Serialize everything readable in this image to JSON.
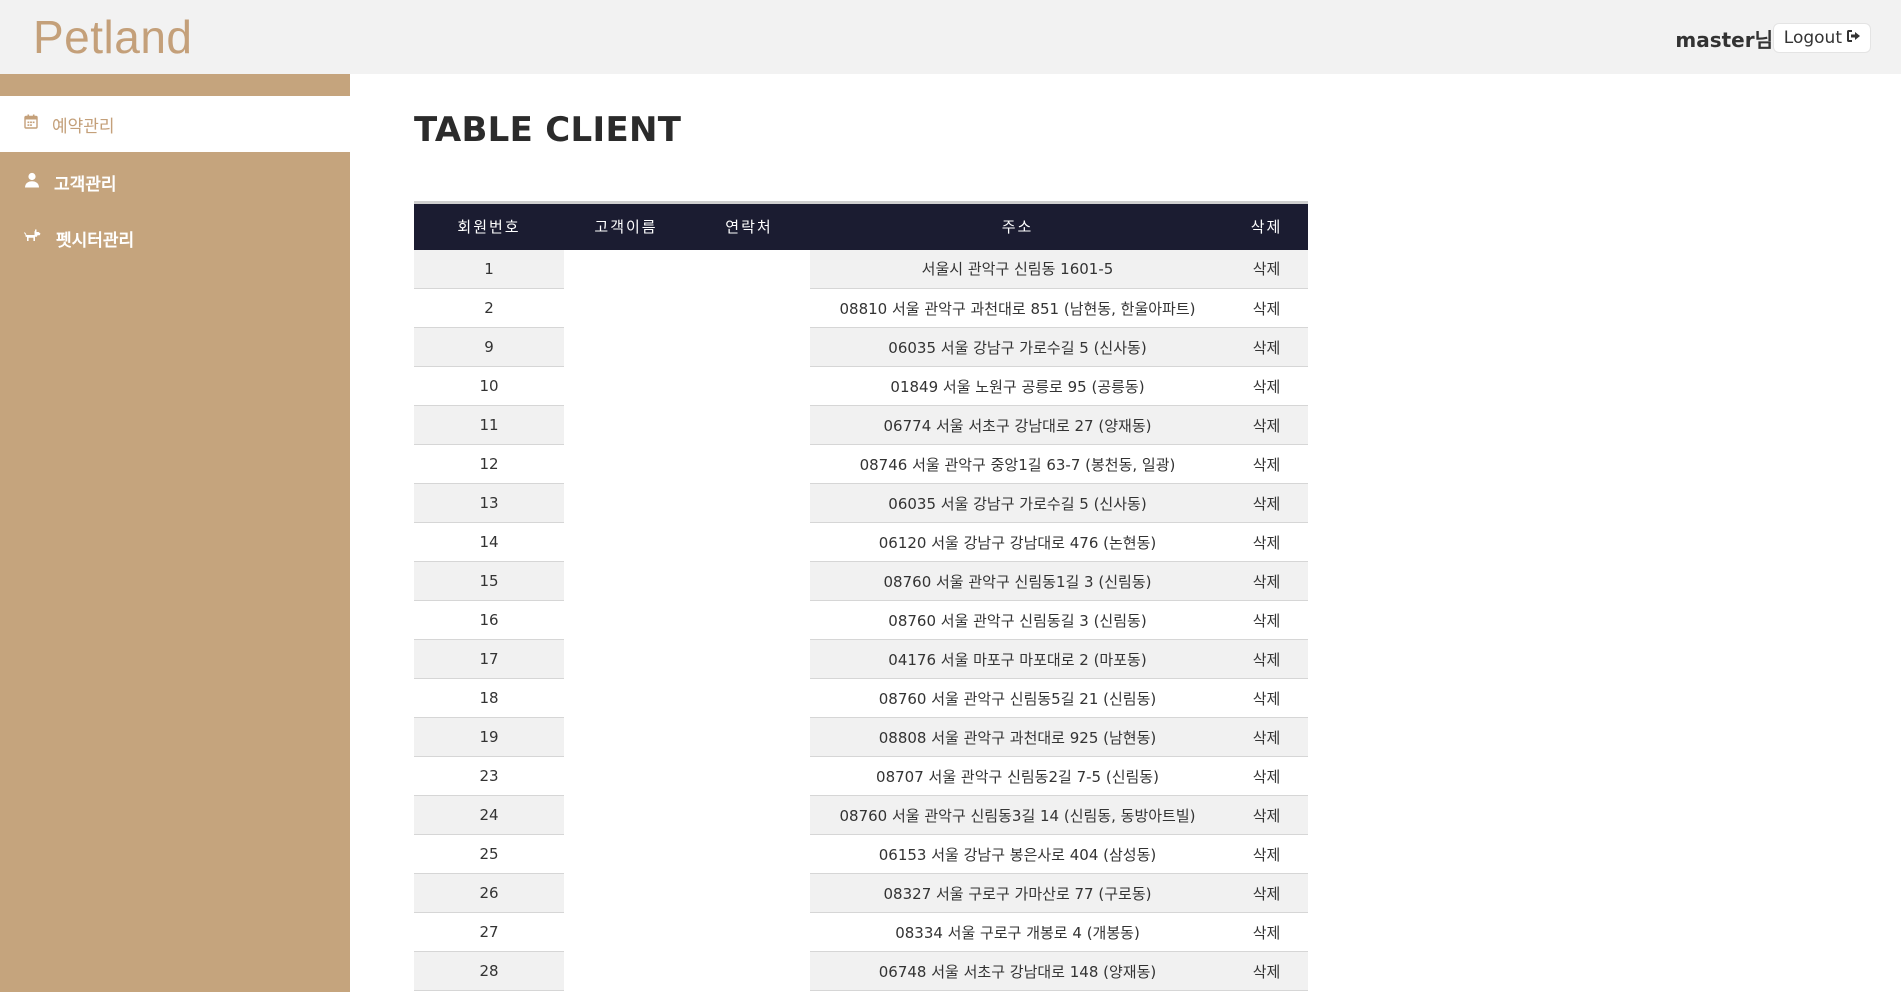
{
  "header": {
    "brand": "Petland",
    "user_greeting": "master님",
    "logout_label": "Logout"
  },
  "sidebar": {
    "items": [
      {
        "label": "예약관리",
        "icon": "calendar-icon",
        "active": true
      },
      {
        "label": "고객관리",
        "icon": "user-icon",
        "active": false
      },
      {
        "label": "펫시터관리",
        "icon": "dog-icon",
        "active": false
      }
    ]
  },
  "main": {
    "title": "TABLE CLIENT",
    "table": {
      "columns": [
        "회원번호",
        "고객이름",
        "연락처",
        "주소",
        "삭제"
      ],
      "rows": [
        {
          "id": "1",
          "name": "",
          "phone": "",
          "address": "서울시 관악구 신림동 1601-5",
          "delete": "삭제"
        },
        {
          "id": "2",
          "name": "",
          "phone": "",
          "address": "08810 서울 관악구 과천대로 851 (남현동, 한울아파트)",
          "delete": "삭제"
        },
        {
          "id": "9",
          "name": "",
          "phone": "",
          "address": "06035 서울 강남구 가로수길 5 (신사동)",
          "delete": "삭제"
        },
        {
          "id": "10",
          "name": "",
          "phone": "",
          "address": "01849 서울 노원구 공릉로 95 (공릉동)",
          "delete": "삭제"
        },
        {
          "id": "11",
          "name": "",
          "phone": "",
          "address": "06774 서울 서초구 강남대로 27 (양재동)",
          "delete": "삭제"
        },
        {
          "id": "12",
          "name": "",
          "phone": "",
          "address": "08746 서울 관악구 중앙1길 63-7 (봉천동, 일광)",
          "delete": "삭제"
        },
        {
          "id": "13",
          "name": "",
          "phone": "",
          "address": "06035 서울 강남구 가로수길 5 (신사동)",
          "delete": "삭제"
        },
        {
          "id": "14",
          "name": "",
          "phone": "",
          "address": "06120 서울 강남구 강남대로 476 (논현동)",
          "delete": "삭제"
        },
        {
          "id": "15",
          "name": "",
          "phone": "",
          "address": "08760 서울 관악구 신림동1길 3 (신림동)",
          "delete": "삭제"
        },
        {
          "id": "16",
          "name": "",
          "phone": "",
          "address": "08760 서울 관악구 신림동길 3 (신림동)",
          "delete": "삭제"
        },
        {
          "id": "17",
          "name": "",
          "phone": "",
          "address": "04176 서울 마포구 마포대로 2 (마포동)",
          "delete": "삭제"
        },
        {
          "id": "18",
          "name": "",
          "phone": "",
          "address": "08760 서울 관악구 신림동5길 21 (신림동)",
          "delete": "삭제"
        },
        {
          "id": "19",
          "name": "",
          "phone": "",
          "address": "08808 서울 관악구 과천대로 925 (남현동)",
          "delete": "삭제"
        },
        {
          "id": "23",
          "name": "",
          "phone": "",
          "address": "08707 서울 관악구 신림동2길 7-5 (신림동)",
          "delete": "삭제"
        },
        {
          "id": "24",
          "name": "",
          "phone": "",
          "address": "08760 서울 관악구 신림동3길 14 (신림동, 동방아트빌)",
          "delete": "삭제"
        },
        {
          "id": "25",
          "name": "",
          "phone": "",
          "address": "06153 서울 강남구 봉은사로 404 (삼성동)",
          "delete": "삭제"
        },
        {
          "id": "26",
          "name": "",
          "phone": "",
          "address": "08327 서울 구로구 가마산로 77 (구로동)",
          "delete": "삭제"
        },
        {
          "id": "27",
          "name": "",
          "phone": "",
          "address": "08334 서울 구로구 개봉로 4 (개봉동)",
          "delete": "삭제"
        },
        {
          "id": "28",
          "name": "",
          "phone": "",
          "address": "06748 서울 서초구 강남대로 148 (양재동)",
          "delete": "삭제"
        }
      ]
    }
  },
  "colors": {
    "brand": "#c4a07a",
    "sidebar_bg": "#c5a47d",
    "table_header_bg": "#1b1c31",
    "topbar_bg": "#f2f2f2"
  }
}
